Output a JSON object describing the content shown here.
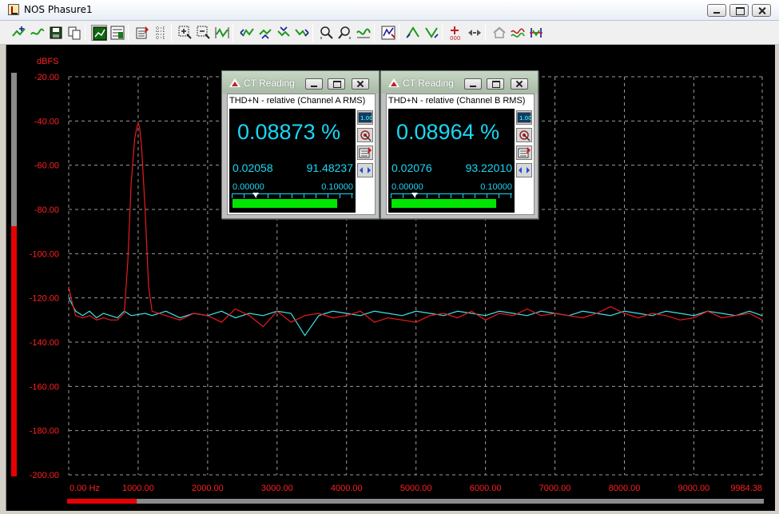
{
  "window": {
    "title": "NOS Phasure1"
  },
  "toolbar": {
    "buttons": [
      {
        "icon": "add-trace-icon"
      },
      {
        "icon": "trace-edit-icon"
      },
      {
        "icon": "save-icon"
      },
      {
        "icon": "copy-icon"
      },
      {
        "icon": "graph-view-icon"
      },
      {
        "icon": "graph-settings-icon"
      },
      {
        "icon": "edit-sheet-icon"
      },
      {
        "icon": "grid-icon"
      },
      {
        "icon": "zoom-in-icon"
      },
      {
        "icon": "zoom-out-icon"
      },
      {
        "icon": "autoscale-icon"
      },
      {
        "icon": "cursor-left-icon"
      },
      {
        "icon": "cursor-up-icon"
      },
      {
        "icon": "cursor-down-icon"
      },
      {
        "icon": "cursor-right-icon"
      },
      {
        "icon": "zoom-x-icon"
      },
      {
        "icon": "zoom-y-icon"
      },
      {
        "icon": "wave-icon"
      },
      {
        "icon": "marker-icon"
      },
      {
        "icon": "peak-up-icon"
      },
      {
        "icon": "peak-down-icon"
      },
      {
        "icon": "signal-gen-icon"
      },
      {
        "icon": "arrows-icon"
      },
      {
        "icon": "home-icon"
      },
      {
        "icon": "overlay-icon"
      },
      {
        "icon": "normalize-icon"
      }
    ]
  },
  "colors": {
    "plot_bg": "#000000",
    "axis_text": "#ff2020",
    "channel_a": "#e81c1c",
    "channel_b": "#3fe0e8",
    "grid": "#9a9a9a",
    "meter_text": "#19d8f5",
    "meter_bar": "#00e600"
  },
  "chart_data": {
    "type": "line",
    "ylabel": "dBFS",
    "ylim": [
      -200,
      -20
    ],
    "yticks": [
      -20,
      -40,
      -60,
      -80,
      -100,
      -120,
      -140,
      -160,
      -180,
      -200
    ],
    "ytick_labels": [
      "-20.00",
      "-40.00",
      "-60.00",
      "-80.00",
      "-100.00",
      "-120.00",
      "-140.00",
      "-160.00",
      "-180.00",
      "-200.00"
    ],
    "xlim": [
      0,
      9984.38
    ],
    "xticks": [
      0,
      1000,
      2000,
      3000,
      4000,
      5000,
      6000,
      7000,
      8000,
      9000,
      9984.38
    ],
    "xtick_labels": [
      "0.00 Hz",
      "1000.00",
      "2000.00",
      "3000.00",
      "4000.00",
      "5000.00",
      "6000.00",
      "7000.00",
      "8000.00",
      "9000.00",
      "9984.38"
    ],
    "grid": true,
    "series": [
      {
        "color": "#e81c1c",
        "x": [
          0,
          50,
          100,
          200,
          300,
          400,
          500,
          600,
          700,
          800,
          850,
          900,
          950,
          980,
          1000,
          1020,
          1050,
          1100,
          1150,
          1200,
          1400,
          1600,
          1800,
          2000,
          2200,
          2400,
          2600,
          2800,
          3000,
          3200,
          3400,
          3600,
          3800,
          4000,
          4200,
          4400,
          4600,
          4800,
          5000,
          5200,
          5400,
          5600,
          5800,
          6000,
          6200,
          6400,
          6600,
          6800,
          7000,
          7200,
          7400,
          7600,
          7800,
          8000,
          8200,
          8400,
          8600,
          8800,
          9000,
          9200,
          9400,
          9600,
          9800,
          9984.38
        ],
        "y": [
          -115,
          -122,
          -128,
          -129,
          -128,
          -130,
          -129,
          -130,
          -130,
          -127,
          -104,
          -68,
          -48,
          -43,
          -41,
          -43,
          -52,
          -80,
          -115,
          -126,
          -128,
          -130,
          -127,
          -128,
          -131,
          -125,
          -128,
          -133,
          -126,
          -131,
          -128,
          -127,
          -129,
          -128,
          -126,
          -131,
          -129,
          -130,
          -131,
          -128,
          -127,
          -129,
          -126,
          -130,
          -127,
          -128,
          -125,
          -128,
          -127,
          -128,
          -129,
          -127,
          -124,
          -127,
          -129,
          -127,
          -128,
          -130,
          -129,
          -126,
          -129,
          -128,
          -127,
          -130
        ]
      },
      {
        "color": "#3fe0e8",
        "x": [
          0,
          100,
          200,
          300,
          400,
          500,
          600,
          700,
          800,
          900,
          1100,
          1200,
          1400,
          1600,
          1800,
          2000,
          2200,
          2400,
          2600,
          2800,
          3000,
          3200,
          3400,
          3600,
          3800,
          4000,
          4200,
          4400,
          4600,
          4800,
          5000,
          5200,
          5400,
          5600,
          5800,
          6000,
          6200,
          6400,
          6600,
          6800,
          7000,
          7200,
          7400,
          7600,
          7800,
          8000,
          8200,
          8400,
          8600,
          8800,
          9000,
          9200,
          9400,
          9600,
          9800,
          9984.38
        ],
        "y": [
          -120,
          -126,
          -128,
          -126,
          -129,
          -127,
          -128,
          -129,
          -126,
          -128,
          -127,
          -128,
          -126,
          -129,
          -127,
          -128,
          -126,
          -129,
          -127,
          -128,
          -126,
          -127,
          -137,
          -128,
          -126,
          -127,
          -128,
          -126,
          -127,
          -128,
          -126,
          -127,
          -128,
          -126,
          -127,
          -128,
          -126,
          -127,
          -128,
          -126,
          -127,
          -128,
          -126,
          -127,
          -128,
          -126,
          -127,
          -128,
          -126,
          -127,
          -128,
          -126,
          -127,
          -128,
          -126,
          -128
        ]
      }
    ]
  },
  "overview": {
    "left_level": 0.62,
    "bottom_level": 0.1
  },
  "ct_windows": [
    {
      "title": "CT Reading",
      "measure": "THD+N - relative (Channel A RMS)",
      "value": "0.08873 %",
      "sub1": "0.02058",
      "sub2": "91.48237",
      "range_min": "0.00000",
      "range_max": "0.10000",
      "marker_fraction": 0.2,
      "fill_fraction": 0.87
    },
    {
      "title": "CT Reading",
      "measure": "THD+N - relative (Channel B RMS)",
      "value": "0.08964 %",
      "sub1": "0.02076",
      "sub2": "93.22010",
      "range_min": "0.00000",
      "range_max": "0.10000",
      "marker_fraction": 0.2,
      "fill_fraction": 0.87
    }
  ]
}
